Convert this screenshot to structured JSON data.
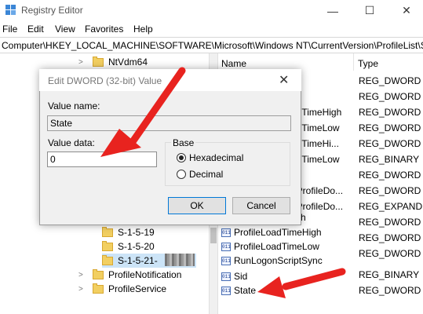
{
  "window": {
    "title": "Registry Editor",
    "minimize": "—",
    "maximize": "☐",
    "close": "✕"
  },
  "menu": [
    "File",
    "Edit",
    "View",
    "Favorites",
    "Help"
  ],
  "address": "Computer\\HKEY_LOCAL_MACHINE\\SOFTWARE\\Microsoft\\Windows NT\\CurrentVersion\\ProfileList\\S-",
  "tree": {
    "top_item": "NtVdm64",
    "profile_items": [
      "S-1-5-19",
      "S-1-5-20",
      "S-1-5-21-"
    ],
    "bottom_items": [
      "ProfileNotification",
      "ProfileService"
    ]
  },
  "list": {
    "header": {
      "name": "Name",
      "type": "Type"
    },
    "types": [
      "REG_DWORD",
      "REG_DWORD",
      "REG_DWORD",
      "REG_DWORD",
      "REG_DWORD",
      "REG_BINARY",
      "REG_DWORD",
      "REG_DWORD",
      "REG_EXPAND",
      "REG_DWORD",
      "REG_DWORD",
      "REG_DWORD",
      "REG_BINARY",
      "REG_DWORD"
    ],
    "partial_names": [
      "adTimeHigh",
      "adTimeLow",
      "adTimeHi...",
      "adTimeLow",
      "dProfileDo...",
      "dProfileDo...",
      "h"
    ],
    "rows": [
      {
        "name": "ProfileLoadTimeHigh"
      },
      {
        "name": "ProfileLoadTimeLow"
      },
      {
        "name": "RunLogonScriptSync"
      },
      {
        "name": "Sid"
      },
      {
        "name": "State"
      }
    ],
    "icon_text": "011"
  },
  "dialog": {
    "title": "Edit DWORD (32-bit) Value",
    "close": "✕",
    "value_name_label": "Value name:",
    "value_name": "State",
    "value_data_label": "Value data:",
    "value_data": "0",
    "base_label": "Base",
    "hex_label": "Hexadecimal",
    "dec_label": "Decimal",
    "base_selected": "Hexadecimal",
    "ok": "OK",
    "cancel": "Cancel"
  },
  "colors": {
    "arrow": "#e8231f",
    "selection": "#cce4f7",
    "accent": "#0078d7"
  }
}
